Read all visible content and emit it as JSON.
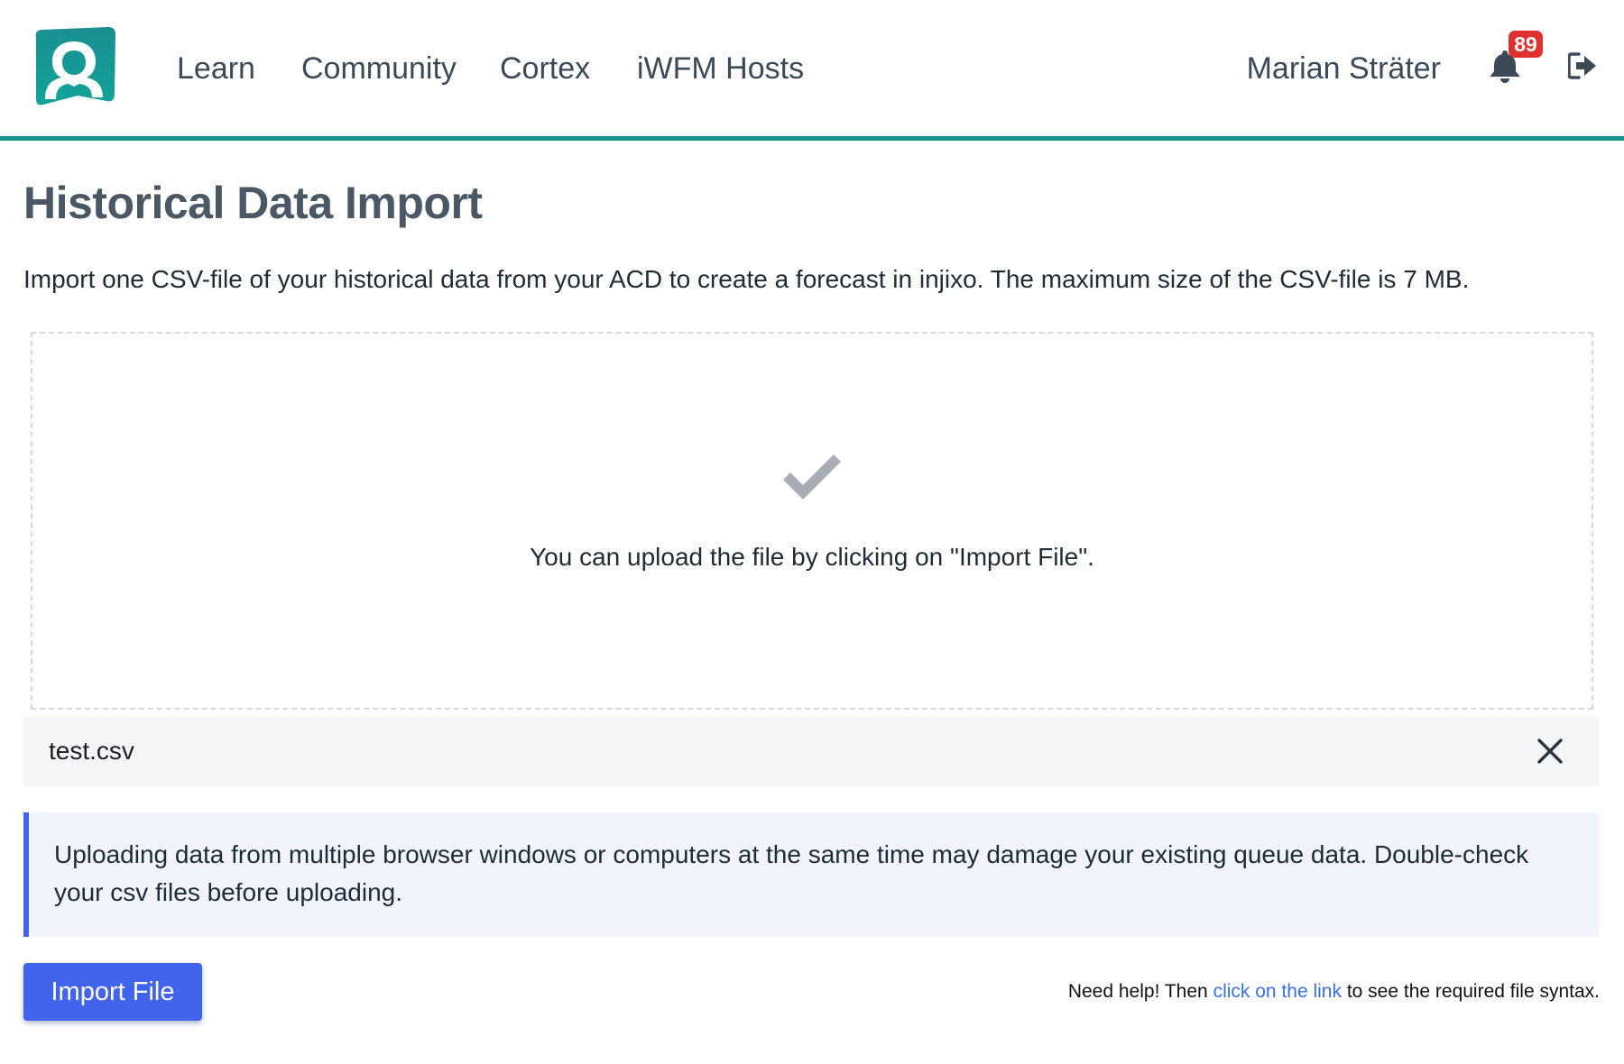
{
  "header": {
    "nav": {
      "learn": "Learn",
      "community": "Community",
      "cortex": "Cortex",
      "iwfm_hosts": "iWFM Hosts"
    },
    "user_name": "Marian Sträter",
    "notifications_count": "89",
    "logo_icon": "user-silhouette-logo-icon",
    "bell_icon": "bell-icon",
    "logout_icon": "sign-out-icon"
  },
  "main": {
    "title": "Historical Data Import",
    "intro": "Import one CSV-file of your historical data from your ACD to create a forecast in injixo. The maximum size of the CSV-file is 7 MB.",
    "dropzone": {
      "icon": "checkmark-icon",
      "message": "You can upload the file by clicking on \"Import File\"."
    },
    "file": {
      "name": "test.csv",
      "remove_icon": "close-icon"
    },
    "notice": "Uploading data from multiple browser windows or computers at the same time may damage your existing queue data. Double-check your csv files before uploading.",
    "import_button": "Import File",
    "help": {
      "prefix": "Need help! Then",
      "link": "click on the link",
      "suffix": "to see the required file syntax."
    }
  },
  "colors": {
    "accent_teal": "#14918a",
    "primary_blue": "#4263eb",
    "badge_red": "#e03131",
    "notice_bg": "#f1f4fc",
    "link_blue": "#3b6fe0"
  }
}
